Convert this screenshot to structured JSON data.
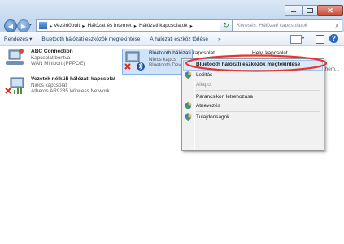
{
  "breadcrumb": [
    "Vezérlőpult",
    "Hálózat és internet",
    "Hálózati kapcsolatok"
  ],
  "search": {
    "placeholder": "Keresés: Hálózati kapcsolatok"
  },
  "toolbar": {
    "organize": "Rendezés",
    "view_bt": "Bluetooth hálózati eszközök megtekintése",
    "rename": "A hálózati eszköz törlése",
    "more": "»"
  },
  "connections": [
    {
      "name": "ABC Connection",
      "status": "Kapcsolat bontva",
      "device": "WAN Miniport (PPPOE)"
    },
    {
      "name": "Vezeték nélküli hálózati kapcsolat",
      "status": "Nincs kapcsolat",
      "device": "Atheros AR9285 Wireless Network..."
    },
    {
      "name": "Bluetooth hálózati kapcsolat",
      "status": "Nincs kapcs",
      "device": "Bluetooth Dev"
    },
    {
      "name": "Helyi kapcsolat",
      "status": "",
      "device": "them..."
    }
  ],
  "context_menu": {
    "items": [
      {
        "label": "Bluetooth hálózati eszközök megtekintése",
        "bold": true
      },
      {
        "label": "Letiltás"
      },
      {
        "label": "Állapot",
        "disabled": true
      },
      {
        "label": "Parancsikon létrehozása"
      },
      {
        "label": "Átnevezés"
      },
      {
        "label": "Tulajdonságok"
      }
    ]
  },
  "colors": {
    "highlight": "#e8352b",
    "link": "#1e395b"
  }
}
